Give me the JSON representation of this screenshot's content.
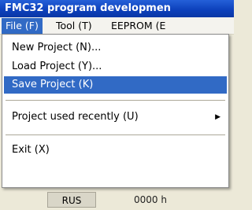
{
  "window": {
    "title": "FMC32 program developmen"
  },
  "menubar": {
    "items": [
      {
        "label": "File (F)"
      },
      {
        "label": "Tool (T)"
      },
      {
        "label": "EEPROM (E"
      }
    ]
  },
  "file_menu": {
    "items": [
      {
        "label": "New Project (N)..."
      },
      {
        "label": "Load Project (Y)..."
      },
      {
        "label": "Save Project (K)"
      },
      {
        "label": "Project used recently (U)"
      },
      {
        "label": "Exit (X)"
      }
    ],
    "submenu_arrow": "▶"
  },
  "background": {
    "rus_label": "RUS",
    "value_text": "0000 h"
  },
  "colors": {
    "title_bar": "#0c3fba",
    "highlight": "#316ac5"
  }
}
